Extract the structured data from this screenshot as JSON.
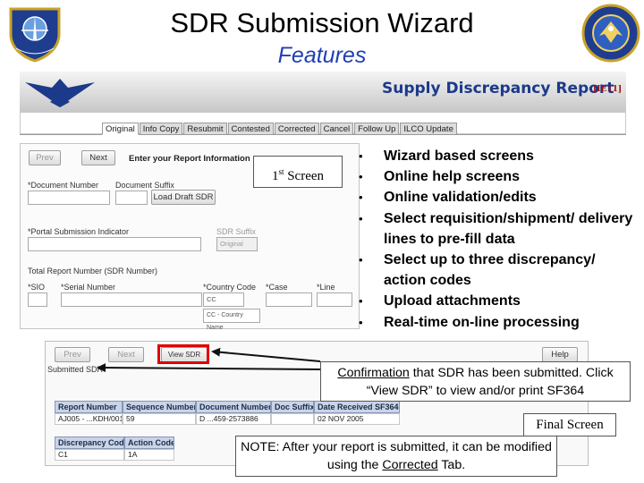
{
  "slide": {
    "title": "SDR Submission Wizard",
    "subtitle": "Features"
  },
  "banner": {
    "title": "Supply Discrepancy Report",
    "code": "[IE11]"
  },
  "tabs": [
    {
      "label": "Original",
      "active": true
    },
    {
      "label": "Info Copy",
      "active": false
    },
    {
      "label": "Resubmit",
      "active": false
    },
    {
      "label": "Contested",
      "active": false
    },
    {
      "label": "Corrected",
      "active": false
    },
    {
      "label": "Cancel",
      "active": false
    },
    {
      "label": "Follow Up",
      "active": false
    },
    {
      "label": "ILCO Update",
      "active": false
    }
  ],
  "form1": {
    "prev_label": "Prev",
    "next_label": "Next",
    "instruction": "Enter your Report Information",
    "doc_number_label": "*Document Number",
    "doc_suffix_label": "Document Suffix",
    "load_draft_label": "Load Draft SDR",
    "portal_label": "*Portal Submission Indicator",
    "sdr_suffix_label": "SDR Suffix",
    "sdr_suffix_value": "Original",
    "total_report_label": "Total Report Number (SDR Number)",
    "sio_label": "*SIO",
    "serial_label": "*Serial Number",
    "country_code_label": "*Country Code",
    "country_code_value": "CC",
    "case_label": "*Case",
    "line_label": "*Line",
    "country_select_value": "CC - Country Name"
  },
  "callouts": {
    "first_screen_prefix": "1",
    "first_screen_sup": "st",
    "first_screen_suffix": " Screen",
    "final_screen": "Final Screen",
    "confirm_u": "Confirmation",
    "confirm_rest": " that SDR has been submitted. Click “View SDR” to view and/or print SF364",
    "note_prefix": "NOTE: After your report is submitted, it can be modified using the ",
    "note_link": "Corrected",
    "note_suffix": " Tab."
  },
  "bullets": [
    "Wizard based screens",
    "Online help screens",
    "Online validation/edits",
    "Select requisition/shipment/ delivery lines to pre-fill data",
    "Select up to three discrepancy/ action codes",
    "Upload attachments",
    "Real-time on-line processing"
  ],
  "form2": {
    "prev_label": "Prev",
    "next_label": "Next",
    "view_sdr_label": "View SDR",
    "help_label": "Help",
    "submitted_label": "Submitted SDR",
    "headers": [
      "Report Number",
      "Sequence Number",
      "Document Number",
      "Doc Suffix",
      "Date Received SF364"
    ],
    "row": [
      "AJ005 - ...KDH/001",
      "59",
      "D   ...459-2573886",
      "",
      "02 NOV 2005"
    ],
    "code_headers": [
      "Discrepancy Code",
      "Action Code"
    ],
    "code_row": [
      "C1",
      "1A"
    ]
  },
  "colors": {
    "subtitle": "#1f3fb4",
    "banner_title": "#1c3a8a",
    "highlight": "#e00000"
  }
}
